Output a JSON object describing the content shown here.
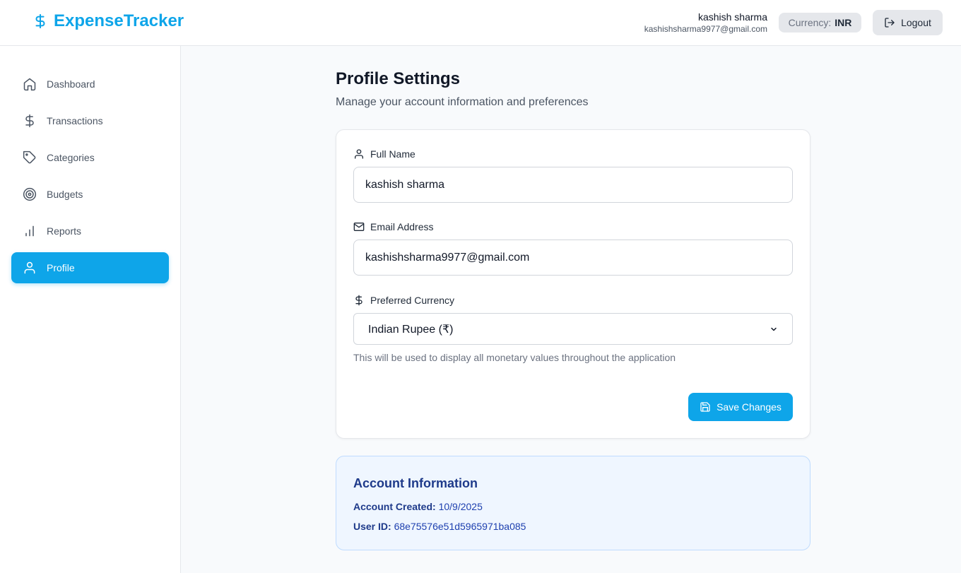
{
  "app": {
    "brand": "ExpenseTracker"
  },
  "header": {
    "user_name": "kashish sharma",
    "user_email": "kashishsharma9977@gmail.com",
    "currency_label": "Currency:",
    "currency_value": "INR",
    "logout_label": "Logout"
  },
  "sidebar": {
    "items": [
      {
        "label": "Dashboard",
        "icon": "home-icon"
      },
      {
        "label": "Transactions",
        "icon": "dollar-icon"
      },
      {
        "label": "Categories",
        "icon": "tag-icon"
      },
      {
        "label": "Budgets",
        "icon": "target-icon"
      },
      {
        "label": "Reports",
        "icon": "bar-chart-icon"
      },
      {
        "label": "Profile",
        "icon": "user-icon",
        "active": true
      }
    ]
  },
  "main": {
    "title": "Profile Settings",
    "subtitle": "Manage your account information and preferences",
    "form": {
      "full_name_label": "Full Name",
      "full_name_value": "kashish sharma",
      "email_label": "Email Address",
      "email_value": "kashishsharma9977@gmail.com",
      "currency_label": "Preferred Currency",
      "currency_selected": "Indian Rupee (₹)",
      "currency_hint": "This will be used to display all monetary values throughout the application",
      "save_label": "Save Changes"
    },
    "account_info": {
      "title": "Account Information",
      "created_label": "Account Created:",
      "created_value": "10/9/2025",
      "user_id_label": "User ID:",
      "user_id_value": "68e75576e51d5965971ba085"
    }
  },
  "colors": {
    "accent": "#0ea5e9",
    "info_bg": "#eff6ff",
    "info_text": "#1e3a8a"
  }
}
